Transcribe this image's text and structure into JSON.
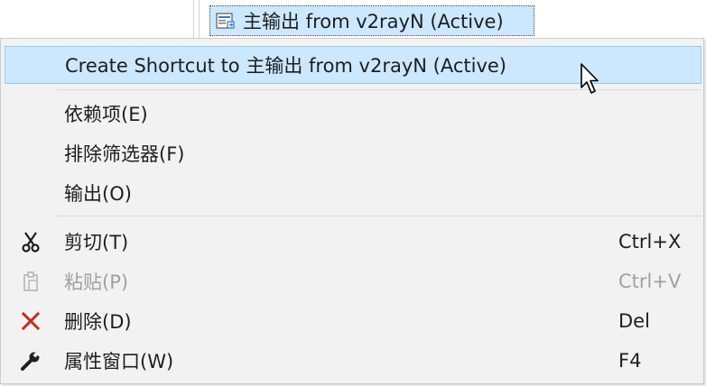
{
  "tree": {
    "selected_item": "主输出 from v2rayN (Active)",
    "icon": "project-output-icon"
  },
  "menu": {
    "items": [
      {
        "label": "Create Shortcut to 主输出 from v2rayN (Active)",
        "shortcut": "",
        "icon": "",
        "state": "highlighted"
      },
      {
        "label": "依赖项(E)",
        "shortcut": "",
        "icon": "",
        "state": "enabled"
      },
      {
        "label": "排除筛选器(F)",
        "shortcut": "",
        "icon": "",
        "state": "enabled"
      },
      {
        "label": "输出(O)",
        "shortcut": "",
        "icon": "",
        "state": "enabled"
      },
      {
        "label": "剪切(T)",
        "shortcut": "Ctrl+X",
        "icon": "scissors-icon",
        "state": "enabled"
      },
      {
        "label": "粘贴(P)",
        "shortcut": "Ctrl+V",
        "icon": "clipboard-icon",
        "state": "disabled"
      },
      {
        "label": "删除(D)",
        "shortcut": "Del",
        "icon": "delete-x-icon",
        "state": "enabled"
      },
      {
        "label": "属性窗口(W)",
        "shortcut": "F4",
        "icon": "wrench-icon",
        "state": "enabled"
      }
    ]
  },
  "colors": {
    "highlight": "#cce8ff",
    "menu_bg": "#f2f2f2",
    "delete_red": "#c42b1c",
    "disabled_text": "#a0a0a0"
  }
}
